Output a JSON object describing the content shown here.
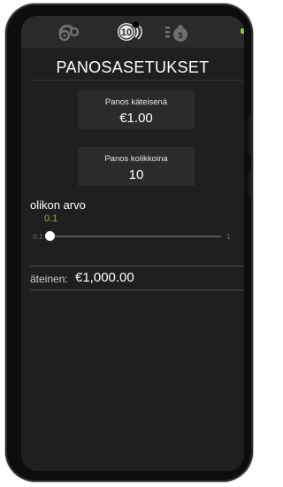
{
  "screen": {
    "title": "PANOSASETUKSET",
    "tabs": [
      {
        "icon": "settings-gears-icon"
      },
      {
        "icon": "coins-icon",
        "label": "10"
      },
      {
        "icon": "money-bag-list-icon"
      }
    ]
  },
  "bet_cash": {
    "label": "Panos käteisenä",
    "value": "€1.00"
  },
  "bet_coins": {
    "label": "Panos kolikkoina",
    "value": "10"
  },
  "coin_value": {
    "label": "olikon arvo",
    "value": "0.1",
    "slider_min": "0.1",
    "slider_max": "1",
    "slider_level": 0
  },
  "balance": {
    "label": "äteinen:",
    "value": "€1,000.00"
  },
  "colors": {
    "accent": "#8cab3c",
    "indicator": "#8cc63f",
    "background": "#1f1f1f"
  }
}
